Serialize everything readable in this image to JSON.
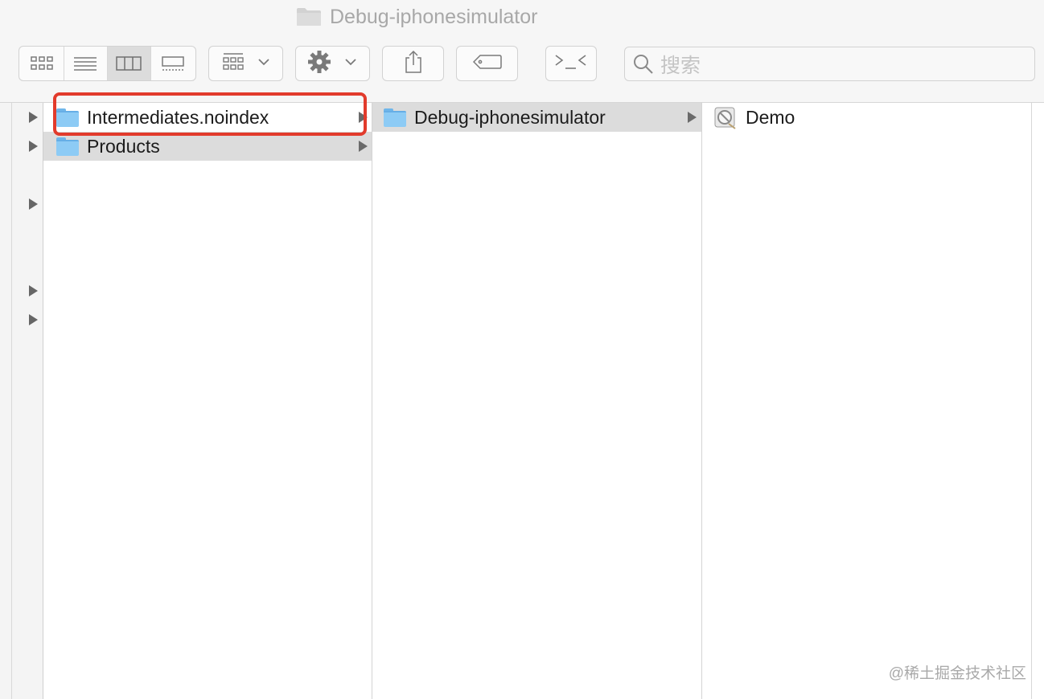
{
  "window": {
    "title": "Debug-iphonesimulator"
  },
  "toolbar": {
    "view_buttons": [
      {
        "name": "icon-view-icon"
      },
      {
        "name": "list-view-icon"
      },
      {
        "name": "column-view-icon",
        "active": true
      },
      {
        "name": "gallery-view-icon"
      }
    ],
    "group_button": "group-icon",
    "action_button": "gear-icon",
    "share_button": "share-icon",
    "tag_button": "tag-icon",
    "terminal_button": "terminal-icon"
  },
  "search": {
    "placeholder": "搜索"
  },
  "columns": [
    {
      "items": [
        {
          "label": "Intermediates.noindex",
          "icon": "folder-icon",
          "has_children": true,
          "selected": false
        },
        {
          "label": "Products",
          "icon": "folder-icon",
          "has_children": true,
          "selected": true
        }
      ]
    },
    {
      "items": [
        {
          "label": "Debug-iphonesimulator",
          "icon": "folder-icon",
          "has_children": true,
          "selected": true
        }
      ]
    },
    {
      "items": [
        {
          "label": "Demo",
          "icon": "app-icon",
          "has_children": false,
          "selected": false
        }
      ]
    }
  ],
  "colors": {
    "highlight": "#e23b2c",
    "folder": "#8dcbf5",
    "selection": "#dcdcdc"
  },
  "watermark": "@稀土掘金技术社区"
}
